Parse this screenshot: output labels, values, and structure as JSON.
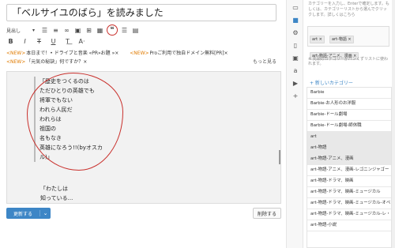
{
  "editor": {
    "title": "「ベルサイユのばら」を読みました",
    "toolbar_heading": "見出し",
    "toolbar_icons": [
      "bold-icon",
      "italic-icon",
      "strikethrough-icon",
      "underline-icon",
      "text-color-icon",
      "clear-format-icon"
    ],
    "ads": {
      "row1": [
        "<NEW>",
        "本日まで！• ドライブと音楽 «PR»お題 »×",
        "<NEW>",
        "Proご利用で独自ドメイン無料[PR]×"
      ],
      "row2": [
        "<NEW>",
        "「元気の秘訣」何ですか？×"
      ],
      "more": "もっと見る"
    },
    "body_lines": [
      "「歴史をつくるのは",
      "ただひとりの英雄でも",
      "将軍でもない",
      "われら人民だ",
      "われらは",
      "祖国の",
      "名もなき",
      "英雄になろう!!(byオスカル)」"
    ],
    "after_lines": [
      "「わたしは",
      "知っている..."
    ]
  },
  "buttons": {
    "update": "更新する",
    "delete": "削除する"
  },
  "sidebar": {
    "description": "カテゴリーを入力し、Enterで確定します。もしくは、カテゴリーリストから選んでクリックします。詳しくはこちら",
    "tags": [
      "art ×",
      "art-物語 ×",
      "art-物語-アニメ、漫画 ×"
    ],
    "note": "※ 先頭のカテゴリーがパンくずリストに使われます。",
    "new_category": "+ 新しいカテゴリー",
    "categories": [
      {
        "label": "Barbie",
        "selected": false
      },
      {
        "label": "Barbie-お人形のお洋服",
        "selected": false
      },
      {
        "label": "Barbie-ドール劇場",
        "selected": false
      },
      {
        "label": "Barbie-ドール劇場-師休職",
        "selected": false
      },
      {
        "label": "art",
        "selected": true
      },
      {
        "label": "art-物語",
        "selected": true
      },
      {
        "label": "art-物語-アニメ、漫画",
        "selected": true
      },
      {
        "label": "art-物語-アニメ、漫画-レゴニンジャゴー",
        "selected": false
      },
      {
        "label": "art-物語-ドラマ、映画",
        "selected": false
      },
      {
        "label": "art-物語-ドラマ、映画-ミュージカル",
        "selected": false
      },
      {
        "label": "art-物語-ドラマ、映画-ミュージカル-オペラ座の怪人",
        "selected": false
      },
      {
        "label": "art-物語-ドラマ、映画-ミュージカル-レ・ミゼラブル",
        "selected": false
      },
      {
        "label": "art-物語-小説",
        "selected": false
      }
    ]
  },
  "colors": {
    "accent": "#3d86c6",
    "annotation": "#c9302c",
    "ad_new": "#e07b00"
  }
}
